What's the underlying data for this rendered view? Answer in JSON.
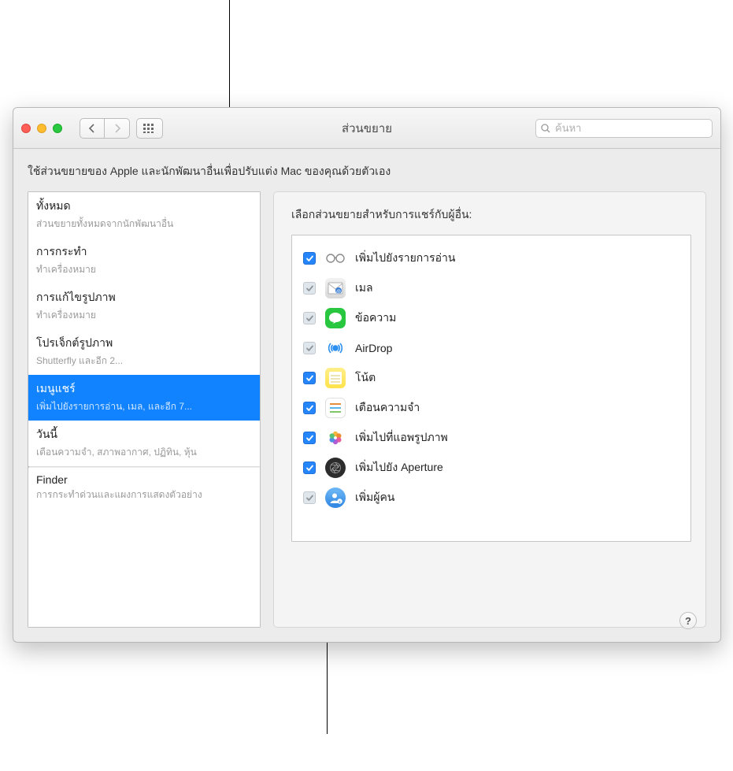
{
  "window": {
    "title": "ส่วนขยาย"
  },
  "search": {
    "placeholder": "ค้นหา"
  },
  "intro": "ใช้ส่วนขยายของ Apple และนักพัฒนาอื่นเพื่อปรับแต่ง Mac ของคุณด้วยตัวเอง",
  "sidebar": {
    "items": [
      {
        "title": "ทั้งหมด",
        "sub": "ส่วนขยายทั้งหมดจากนักพัฒนาอื่น"
      },
      {
        "title": "การกระทำ",
        "sub": "ทำเครื่องหมาย"
      },
      {
        "title": "การแก้ไขรูปภาพ",
        "sub": "ทำเครื่องหมาย"
      },
      {
        "title": "โปรเจ็กต์รูปภาพ",
        "sub": "Shutterfly และอีก 2..."
      },
      {
        "title": "เมนูแชร์",
        "sub": "เพิ่มไปยังรายการอ่าน, เมล, และอีก 7..."
      },
      {
        "title": "วันนี้",
        "sub": "เตือนความจำ, สภาพอากาศ, ปฏิทิน, หุ้น"
      },
      {
        "title": "Finder",
        "sub": "การกระทำด่วนและแผงการแสดงตัวอย่าง"
      }
    ]
  },
  "panel": {
    "heading": "เลือกส่วนขยายสำหรับการแชร์กับผู้อื่น:",
    "rows": [
      {
        "label": "เพิ่มไปยังรายการอ่าน",
        "checked": true,
        "dim": false,
        "icon": "glasses"
      },
      {
        "label": "เมล",
        "checked": true,
        "dim": true,
        "icon": "mail"
      },
      {
        "label": "ข้อความ",
        "checked": true,
        "dim": true,
        "icon": "messages"
      },
      {
        "label": "AirDrop",
        "checked": true,
        "dim": true,
        "icon": "airdrop"
      },
      {
        "label": "โน้ต",
        "checked": true,
        "dim": false,
        "icon": "notes"
      },
      {
        "label": "เตือนความจำ",
        "checked": true,
        "dim": false,
        "icon": "reminders"
      },
      {
        "label": "เพิ่มไปที่แอพรูปภาพ",
        "checked": true,
        "dim": false,
        "icon": "photos"
      },
      {
        "label": "เพิ่มไปยัง Aperture",
        "checked": true,
        "dim": false,
        "icon": "aperture"
      },
      {
        "label": "เพิ่มผู้คน",
        "checked": true,
        "dim": true,
        "icon": "contacts"
      }
    ]
  },
  "help": "?"
}
